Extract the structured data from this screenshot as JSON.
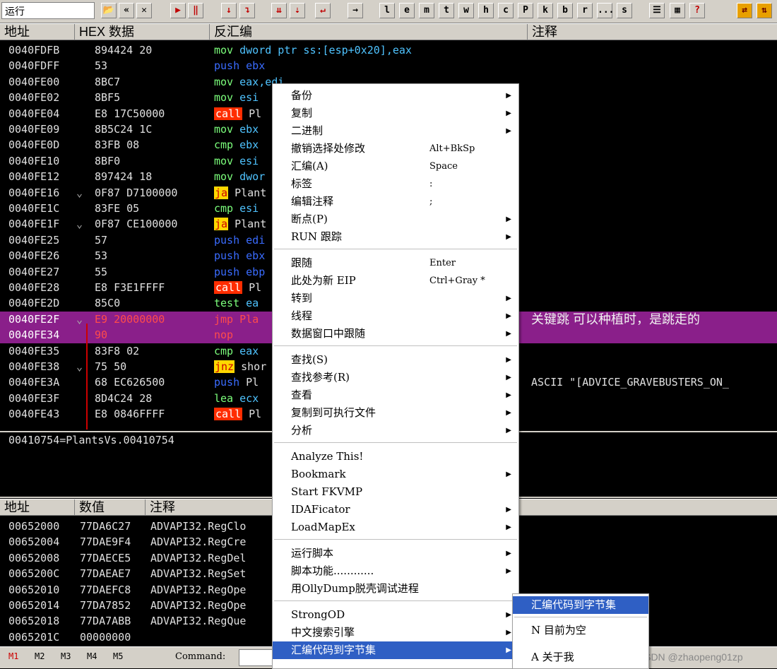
{
  "toolbar": {
    "status": "运行",
    "letters": [
      "l",
      "e",
      "m",
      "t",
      "w",
      "h",
      "c",
      "P",
      "k",
      "b",
      "r",
      "...",
      "s"
    ]
  },
  "cpu_header": {
    "addr": "地址",
    "hex": "HEX 数据",
    "disasm": "反汇编",
    "comment": "注释"
  },
  "code_rows": [
    {
      "addr": "0040FDFB",
      "hex": "894424 20",
      "mn": "mov",
      "mnType": "green",
      "ops": "dword ptr ss:[esp+0x20],eax",
      "opsType": "cyan"
    },
    {
      "addr": "0040FDFF",
      "hex": "53",
      "mn": "push",
      "mnType": "blue",
      "ops": "ebx",
      "opsType": "blue"
    },
    {
      "addr": "0040FE00",
      "hex": "8BC7",
      "mn": "mov",
      "mnType": "green",
      "ops": "eax,edi",
      "opsType": "cyan"
    },
    {
      "addr": "0040FE02",
      "hex": "8BF5",
      "mn": "mov",
      "mnType": "green",
      "ops": "esi",
      "opsType": "cyan"
    },
    {
      "addr": "0040FE04",
      "hex": "E8 17C50000",
      "mn": "call",
      "mnType": "call",
      "ops": "Pl",
      "opsType": "white"
    },
    {
      "addr": "0040FE09",
      "hex": "8B5C24 1C",
      "mn": "mov",
      "mnType": "green",
      "ops": "ebx",
      "opsType": "cyan"
    },
    {
      "addr": "0040FE0D",
      "hex": "83FB 08",
      "mn": "cmp",
      "mnType": "green",
      "ops": "ebx",
      "opsType": "cyan"
    },
    {
      "addr": "0040FE10",
      "hex": "8BF0",
      "mn": "mov",
      "mnType": "green",
      "ops": "esi",
      "opsType": "cyan"
    },
    {
      "addr": "0040FE12",
      "hex": "897424 18",
      "mn": "mov",
      "mnType": "green",
      "ops": "dwor",
      "opsType": "cyan"
    },
    {
      "addr": "0040FE16",
      "hex": "0F87 D7100000",
      "mn": "ja",
      "mnType": "jmp",
      "ops": "Plant",
      "opsType": "white",
      "arrow": "⌄"
    },
    {
      "addr": "0040FE1C",
      "hex": "83FE 05",
      "mn": "cmp",
      "mnType": "green",
      "ops": "esi",
      "opsType": "cyan"
    },
    {
      "addr": "0040FE1F",
      "hex": "0F87 CE100000",
      "mn": "ja",
      "mnType": "jmp",
      "ops": "Plant",
      "opsType": "white",
      "arrow": "⌄"
    },
    {
      "addr": "0040FE25",
      "hex": "57",
      "mn": "push",
      "mnType": "blue",
      "ops": "edi",
      "opsType": "blue"
    },
    {
      "addr": "0040FE26",
      "hex": "53",
      "mn": "push",
      "mnType": "blue",
      "ops": "ebx",
      "opsType": "blue"
    },
    {
      "addr": "0040FE27",
      "hex": "55",
      "mn": "push",
      "mnType": "blue",
      "ops": "ebp",
      "opsType": "blue"
    },
    {
      "addr": "0040FE28",
      "hex": "E8 F3E1FFFF",
      "mn": "call",
      "mnType": "call",
      "ops": "Pl",
      "opsType": "white"
    },
    {
      "addr": "0040FE2D",
      "hex": "85C0",
      "mn": "test",
      "mnType": "green",
      "ops": "ea",
      "opsType": "cyan"
    },
    {
      "addr": "0040FE2F",
      "hex": "E9 20000000",
      "mn": "jmp",
      "mnType": "hl",
      "ops": "Pla",
      "opsType": "hl",
      "arrow": "⌄",
      "hl": true,
      "comment": "关键跳 可以种植时，是跳走的"
    },
    {
      "addr": "0040FE34",
      "hex": "90",
      "mn": "nop",
      "mnType": "hl",
      "ops": "",
      "opsType": "hl",
      "hl": true
    },
    {
      "addr": "0040FE35",
      "hex": "83F8 02",
      "mn": "cmp",
      "mnType": "green",
      "ops": "eax",
      "opsType": "cyan"
    },
    {
      "addr": "0040FE38",
      "hex": "75 50",
      "mn": "jnz",
      "mnType": "jmp",
      "ops": "shor",
      "opsType": "white",
      "arrow": "⌄"
    },
    {
      "addr": "0040FE3A",
      "hex": "68 EC626500",
      "mn": "push",
      "mnType": "blue",
      "ops": "Pl",
      "opsType": "white",
      "comment2": "ASCII \"[ADVICE_GRAVEBUSTERS_ON_"
    },
    {
      "addr": "0040FE3F",
      "hex": "8D4C24 28",
      "mn": "lea",
      "mnType": "green",
      "ops": "ecx",
      "opsType": "cyan"
    },
    {
      "addr": "0040FE43",
      "hex": "E8 0846FFFF",
      "mn": "call",
      "mnType": "call",
      "ops": "Pl",
      "opsType": "white"
    }
  ],
  "info_line": "00410754=PlantsVs.00410754",
  "stack_header": {
    "addr": "地址",
    "value": "数值",
    "comment": "注释"
  },
  "stack_rows": [
    {
      "addr": "00652000",
      "val": "77DA6C27",
      "cmt": "ADVAPI32.RegClo"
    },
    {
      "addr": "00652004",
      "val": "77DAE9F4",
      "cmt": "ADVAPI32.RegCre"
    },
    {
      "addr": "00652008",
      "val": "77DAECE5",
      "cmt": "ADVAPI32.RegDel"
    },
    {
      "addr": "0065200C",
      "val": "77DAEAE7",
      "cmt": "ADVAPI32.RegSet"
    },
    {
      "addr": "00652010",
      "val": "77DAEFC8",
      "cmt": "ADVAPI32.RegOpe"
    },
    {
      "addr": "00652014",
      "val": "77DA7852",
      "cmt": "ADVAPI32.RegOpe"
    },
    {
      "addr": "00652018",
      "val": "77DA7ABB",
      "cmt": "ADVAPI32.RegQue"
    },
    {
      "addr": "0065201C",
      "val": "00000000",
      "cmt": ""
    }
  ],
  "context_menu": [
    {
      "label": "备份",
      "arrow": true
    },
    {
      "label": "复制",
      "arrow": true
    },
    {
      "label": "二进制",
      "arrow": true
    },
    {
      "label": "撤销选择处修改",
      "sc": "Alt+BkSp"
    },
    {
      "label": "汇编(A)",
      "sc": "Space"
    },
    {
      "label": "标签",
      "sc": ":"
    },
    {
      "label": "编辑注释",
      "sc": ";"
    },
    {
      "label": "断点(P)",
      "arrow": true
    },
    {
      "label": "RUN 跟踪",
      "arrow": true,
      "sepAfter": true
    },
    {
      "label": "跟随",
      "sc": "Enter"
    },
    {
      "label": "此处为新 EIP",
      "sc": "Ctrl+Gray *"
    },
    {
      "label": "转到",
      "arrow": true
    },
    {
      "label": "线程",
      "arrow": true
    },
    {
      "label": "数据窗口中跟随",
      "arrow": true,
      "sepAfter": true
    },
    {
      "label": "查找(S)",
      "arrow": true
    },
    {
      "label": "查找参考(R)",
      "arrow": true
    },
    {
      "label": "查看",
      "arrow": true
    },
    {
      "label": "复制到可执行文件",
      "arrow": true
    },
    {
      "label": "分析",
      "arrow": true,
      "sepAfter": true
    },
    {
      "label": "Analyze This!"
    },
    {
      "label": "Bookmark",
      "arrow": true
    },
    {
      "label": "Start FKVMP"
    },
    {
      "label": "IDAFicator",
      "arrow": true
    },
    {
      "label": "LoadMapEx",
      "arrow": true,
      "sepAfter": true
    },
    {
      "label": "运行脚本",
      "arrow": true
    },
    {
      "label": "脚本功能............",
      "arrow": true
    },
    {
      "label": "用OllyDump脱壳调试进程",
      "sepAfter": true
    },
    {
      "label": "StrongOD",
      "arrow": true
    },
    {
      "label": "中文搜索引擎",
      "arrow": true
    },
    {
      "label": "汇编代码到字节集",
      "arrow": true,
      "selected": true
    }
  ],
  "submenu": [
    {
      "label": "汇编代码到字节集",
      "selected": true
    },
    {
      "label": "N 目前为空"
    },
    {
      "label": "A 关于我"
    }
  ],
  "statusbar": {
    "m": [
      "M1",
      "M2",
      "M3",
      "M4",
      "M5"
    ],
    "command_label": "Command:"
  },
  "watermark": "CSDN @zhaopeng01zp"
}
